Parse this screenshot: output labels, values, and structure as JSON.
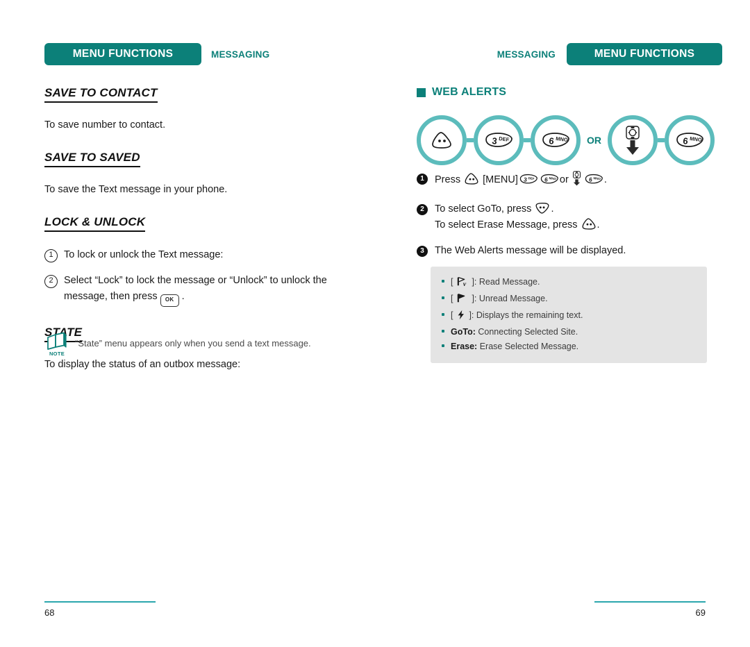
{
  "left_page": {
    "header": {
      "badge": "MENU FUNCTIONS",
      "section": "MESSAGING"
    },
    "sections": [
      {
        "title": "SAVE TO CONTACT",
        "body": "To save number to contact."
      },
      {
        "title": "SAVE TO SAVED",
        "body": "To save the Text message in your phone."
      },
      {
        "title": "LOCK & UNLOCK",
        "items": [
          {
            "num": "1",
            "text": "To lock or unlock the Text message:"
          },
          {
            "num": "2",
            "text_before": "Select “Lock” to lock the message or “Unlock” to unlock the message, then press",
            "key": "OK",
            "text_after": "."
          }
        ]
      },
      {
        "title": "STATE",
        "body": "To display the status of an outbox message:"
      }
    ],
    "note": {
      "icon_label": "NOTE",
      "text": "“State” menu appears only when you send a text message."
    },
    "footer": {
      "page_number": "68"
    }
  },
  "right_page": {
    "header": {
      "badge": "MENU FUNCTIONS",
      "section": "MESSAGING"
    },
    "section_title": "WEB ALERTS",
    "key_flow": {
      "or_label": "OR",
      "group_a": [
        {
          "type": "softkey",
          "label": ""
        },
        {
          "type": "numkey",
          "digit": "3",
          "letters": "DEF"
        },
        {
          "type": "numkey",
          "digit": "6",
          "letters": "MNO"
        }
      ],
      "group_b": [
        {
          "type": "navkey-down",
          "label": ""
        },
        {
          "type": "numkey",
          "digit": "6",
          "letters": "MNO"
        }
      ]
    },
    "steps": [
      {
        "num": "1",
        "parts": [
          "Press",
          "[MENU]",
          "or",
          "."
        ],
        "text": "Press ⬚ [MENU] 3DEF 6MNO or ⬚ 6MNO ."
      },
      {
        "num": "2",
        "line1_before": "To select GoTo, press",
        "line1_after": ".",
        "line2_before": "To select Erase Message, press",
        "line2_after": "."
      },
      {
        "num": "3",
        "text": "The Web Alerts message will be displayed."
      }
    ],
    "info_box": [
      {
        "icon": "read-message-icon",
        "bracket_open": "[",
        "bracket_close": "]:",
        "label": "Read Message."
      },
      {
        "icon": "unread-message-icon",
        "bracket_open": "[",
        "bracket_close": "]:",
        "label": "Unread Message."
      },
      {
        "icon": "lightning-icon",
        "bracket_open": "[",
        "bracket_close": "]:",
        "label": "Displays the remaining text."
      },
      {
        "bold": "GoTo:",
        "label": "Connecting Selected Site."
      },
      {
        "bold": "Erase:",
        "label": "Erase Selected Message."
      }
    ],
    "footer": {
      "page_number": "69"
    }
  },
  "colors": {
    "teal_dark": "#0c8079",
    "teal_ring": "#5cbcbc",
    "rule": "#2ba6ad",
    "infobox_bg": "#e4e4e4"
  }
}
